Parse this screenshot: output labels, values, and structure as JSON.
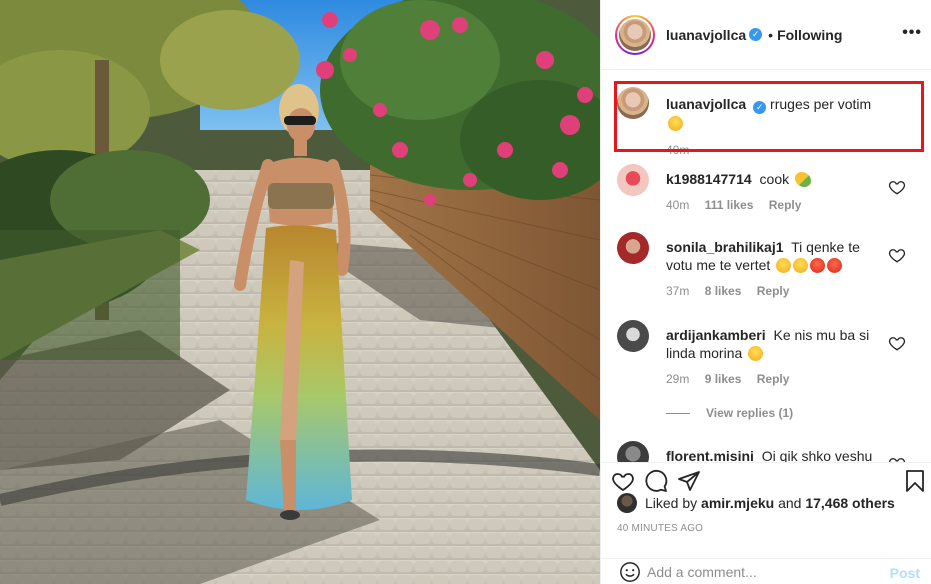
{
  "post": {
    "username": "luanavjollca",
    "follow_status": "Following",
    "more_label": "•••"
  },
  "caption": {
    "username": "luanavjollca",
    "text": "rruges per votim",
    "time": "40m"
  },
  "comments": [
    {
      "username": "k1988147714",
      "text": "cook",
      "time": "40m",
      "likes": "111 likes",
      "reply": "Reply"
    },
    {
      "username": "sonila_brahilikaj1",
      "text": "Ti qenke te votu me te vertet",
      "time": "37m",
      "likes": "8 likes",
      "reply": "Reply"
    },
    {
      "username": "ardijankamberi",
      "text": "Ke nis mu ba si linda morina",
      "time": "29m",
      "likes": "9 likes",
      "reply": "Reply",
      "view_replies": "View replies (1)"
    },
    {
      "username": "florent.misini",
      "text": "Oi qik shko veshu"
    }
  ],
  "likes": {
    "prefix": "Liked by",
    "user": "amir.mjeku",
    "connector": "and",
    "others": "17,468 others"
  },
  "time_ago": "40 MINUTES AGO",
  "add_comment": {
    "placeholder": "Add a comment...",
    "post_label": "Post"
  },
  "colors": {
    "accent": "#3897f0",
    "highlight_box": "#e8161b",
    "post_disabled": "#b2dffc",
    "muted": "#8e8e8e"
  }
}
